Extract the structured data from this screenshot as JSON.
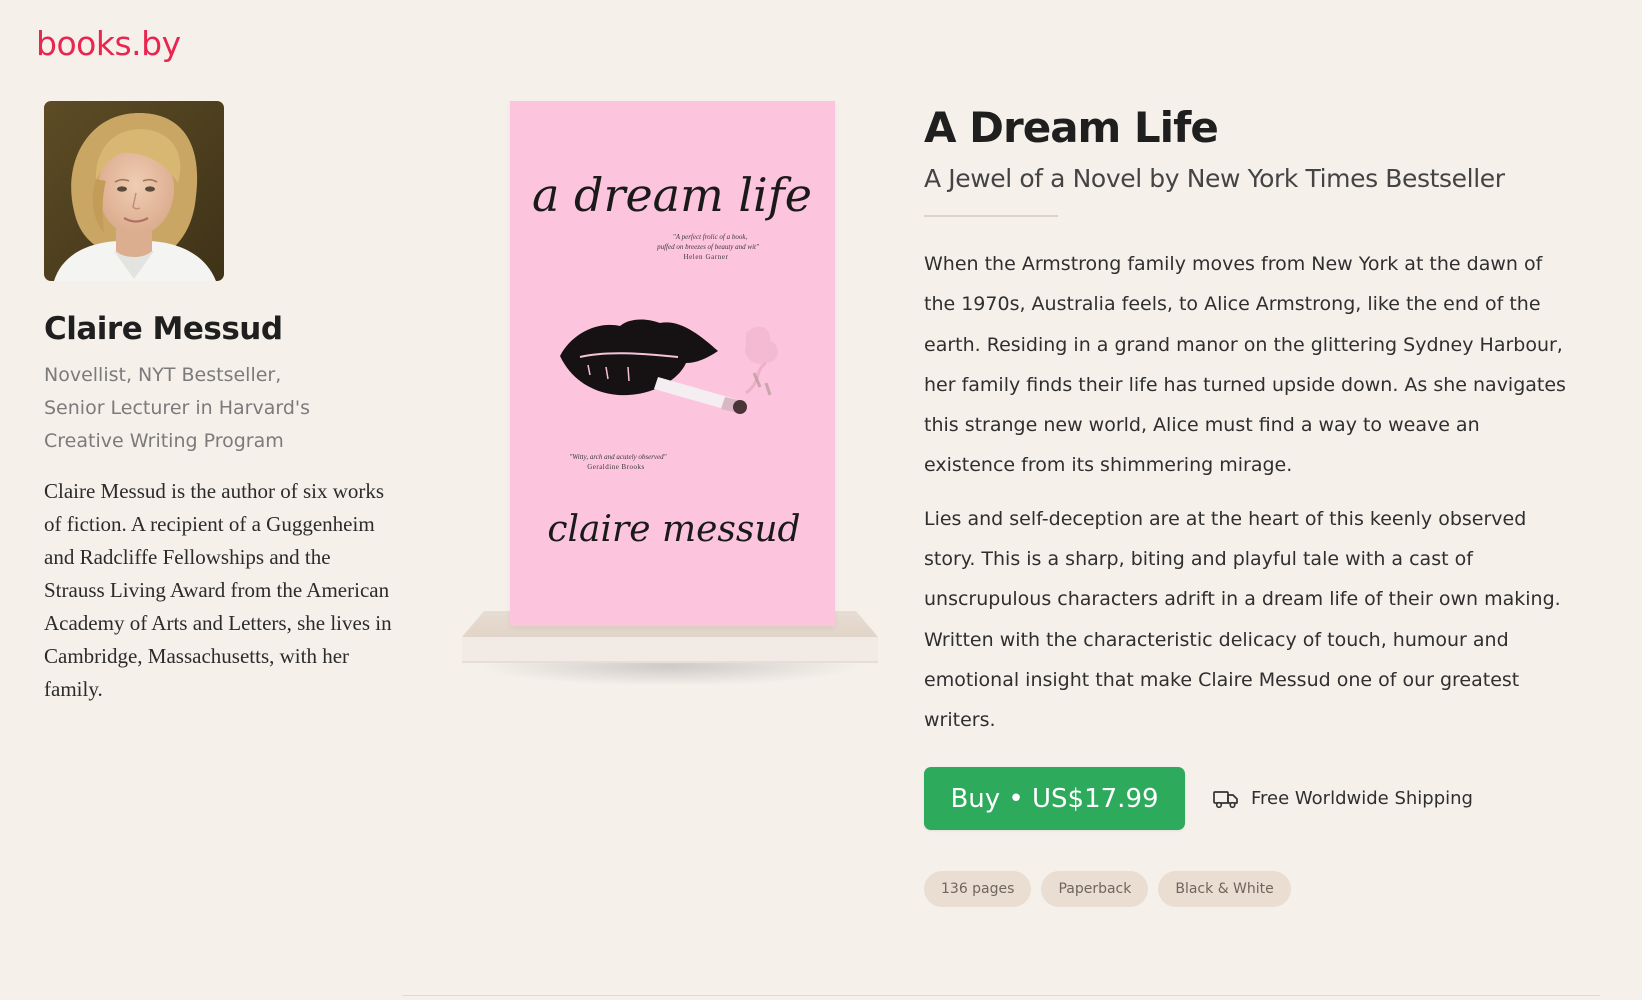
{
  "brand": {
    "name": "books.by",
    "color": "#e8264f"
  },
  "author": {
    "photo_alt": "Claire Messud",
    "name": "Claire Messud",
    "roles": [
      "Novellist, NYT Bestseller,",
      "Senior Lecturer in Harvard's",
      "Creative Writing Program"
    ],
    "bio": "Claire Messud is the author of six works of fiction. A recipient of a Guggenheim and Radcliffe Fellowships and the Strauss Living Award from the American Academy of Arts and Letters, she lives in Cambridge, Massachusetts, with her family."
  },
  "book": {
    "cover": {
      "title": "a dream life",
      "quote_top_line1": "\"A perfect frolic of a book,",
      "quote_top_line2": "puffed on breezes of beauty and wit\"",
      "quote_top_author": "Helen Garner",
      "quote_bottom": "\"Witty, arch and acutely observed\"",
      "quote_bottom_author": "Geraldine Brooks",
      "author": "claire messud",
      "color": "#fdc4dd"
    },
    "title": "A Dream Life",
    "subtitle": "A Jewel of a Novel by New York Times Bestseller",
    "description": [
      "When the Armstrong family moves from New York at the dawn of the 1970s, Australia feels, to Alice Armstrong, like the end of the earth. Residing in a grand manor on the glittering Sydney Harbour, her family finds their life has turned upside down. As she navigates this strange new world, Alice must find a way to weave an existence from its shimmering mirage.",
      "Lies and self-deception are at the heart of this keenly observed story. This is a sharp, biting and playful tale with a cast of unscrupulous characters adrift in a dream life of their own making. Written with the characteristic delicacy of touch, humour and emotional insight that make Claire Messud one of our greatest writers."
    ],
    "buy_label": "Buy • US$17.99",
    "shipping_label": "Free Worldwide Shipping",
    "shipping_icon": "truck-icon",
    "tags": [
      "136 pages",
      "Paperback",
      "Black & White"
    ]
  },
  "colors": {
    "background": "#f6f0eb",
    "buy_button": "#2eaa5d",
    "tag_background": "#eaddd2"
  }
}
